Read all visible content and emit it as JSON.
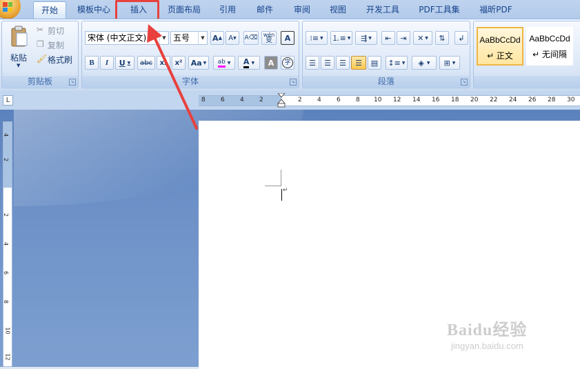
{
  "tabs": [
    {
      "label": "开始",
      "active": true
    },
    {
      "label": "模板中心"
    },
    {
      "label": "插入"
    },
    {
      "label": "页面布局"
    },
    {
      "label": "引用"
    },
    {
      "label": "邮件"
    },
    {
      "label": "审阅"
    },
    {
      "label": "视图"
    },
    {
      "label": "开发工具"
    },
    {
      "label": "PDF工具集"
    },
    {
      "label": "福昕PDF"
    }
  ],
  "clipboard": {
    "group_label": "剪贴板",
    "paste": "粘贴",
    "cut": "剪切",
    "copy": "复制",
    "format_painter": "格式刷"
  },
  "font": {
    "group_label": "字体",
    "font_name": "宋体 (中文正文)",
    "font_size": "五号",
    "grow": "A",
    "shrink": "A",
    "phonetic": "wén",
    "phonetic_char": "变",
    "border_char": "A",
    "bold": "B",
    "italic": "I",
    "underline": "U",
    "strike": "abc",
    "subscript": "x₂",
    "superscript": "x²",
    "change_case": "Aa",
    "highlight": "ab",
    "font_color": "A",
    "shading_char": "A",
    "enclose_char": "字"
  },
  "paragraph": {
    "group_label": "段落"
  },
  "styles": {
    "items": [
      {
        "sample": "AaBbCcDd",
        "name": "↵ 正文",
        "selected": true
      },
      {
        "sample": "AaBbCcDd",
        "name": "↵ 无间隔"
      }
    ]
  },
  "ruler": {
    "h_numbers": [
      "8",
      "6",
      "4",
      "2",
      "2",
      "4",
      "6",
      "8",
      "10",
      "12",
      "14",
      "16",
      "18",
      "20",
      "22",
      "24",
      "26",
      "28",
      "30"
    ],
    "v_numbers": [
      "4",
      "2",
      "2",
      "4",
      "6",
      "8",
      "10",
      "12"
    ],
    "corner_symbol": "L"
  },
  "document": {
    "paragraph_mark": "↵"
  },
  "watermark": {
    "brand": "Baidu经验",
    "url": "jingyan.baidu.com"
  },
  "colors": {
    "highlight_box": "#e8413d",
    "workspace": "#6e92c8",
    "ribbon_text": "#15428b"
  }
}
